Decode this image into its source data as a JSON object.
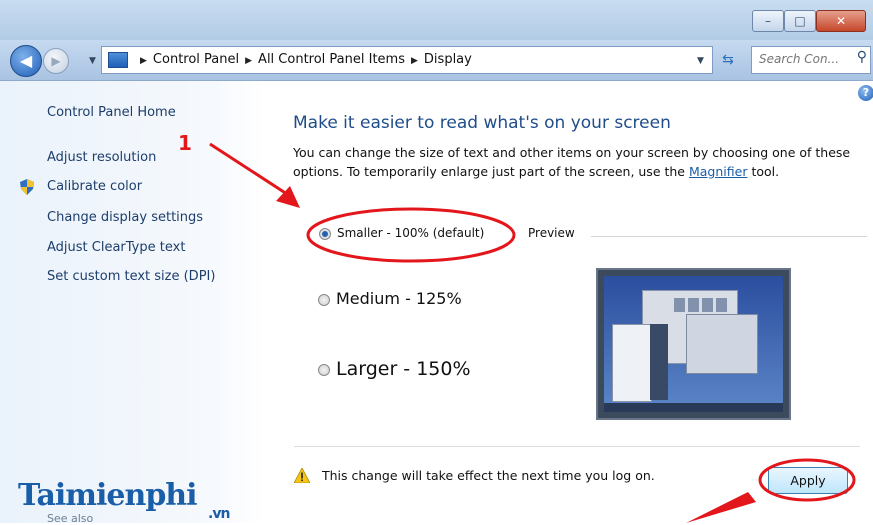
{
  "window": {
    "controls": {
      "minimize": "–",
      "maximize": "□",
      "close": "✕"
    }
  },
  "nav": {
    "back_icon": "back-arrow-icon",
    "forward_icon": "forward-arrow-icon",
    "breadcrumbs": [
      "Control Panel",
      "All Control Panel Items",
      "Display"
    ],
    "search_placeholder": "Search Con..."
  },
  "sidebar": {
    "items": [
      "Control Panel Home",
      "Adjust resolution",
      "Calibrate color",
      "Change display settings",
      "Adjust ClearType text",
      "Set custom text size (DPI)"
    ],
    "see_also": "See also"
  },
  "logo": {
    "name": "Taimienphi",
    "suffix": ".vn"
  },
  "main": {
    "heading": "Make it easier to read what's on your screen",
    "description_before": "You can change the size of text and other items on your screen by choosing one of these options. To temporarily enlarge just part of the screen, use the ",
    "magnifier_link": "Magnifier",
    "description_after": " tool.",
    "options": [
      {
        "label": "Smaller - 100% (default)",
        "selected": true
      },
      {
        "label": "Medium - 125%",
        "selected": false
      },
      {
        "label": "Larger - 150%",
        "selected": false
      }
    ],
    "preview_label": "Preview",
    "notice": "This change will take effect the next time you log on.",
    "apply_label": "Apply"
  },
  "annotations": {
    "step_number": "1",
    "color": "#e3171b"
  }
}
